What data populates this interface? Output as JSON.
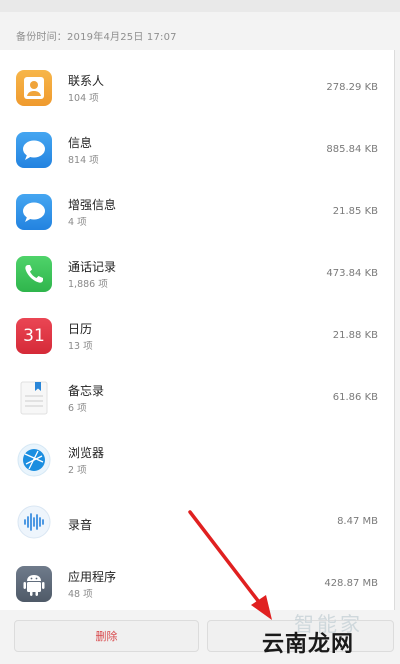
{
  "header": {
    "backup_time": "备份时间：2019年4月25日 17:07"
  },
  "items": [
    {
      "name": "联系人",
      "count": "104 项",
      "size": "278.29 KB",
      "icon": "contacts-icon"
    },
    {
      "name": "信息",
      "count": "814 项",
      "size": "885.84 KB",
      "icon": "messages-icon"
    },
    {
      "name": "增强信息",
      "count": "4 项",
      "size": "21.85 KB",
      "icon": "enhanced-messages-icon"
    },
    {
      "name": "通话记录",
      "count": "1,886 项",
      "size": "473.84 KB",
      "icon": "phone-icon"
    },
    {
      "name": "日历",
      "count": "13 项",
      "size": "21.88 KB",
      "icon": "calendar-icon",
      "icon_text": "31"
    },
    {
      "name": "备忘录",
      "count": "6 项",
      "size": "61.86 KB",
      "icon": "memo-icon"
    },
    {
      "name": "浏览器",
      "count": "2 项",
      "size": "",
      "icon": "browser-icon"
    },
    {
      "name": "录音",
      "count": "",
      "size": "8.47 MB",
      "icon": "recorder-icon"
    },
    {
      "name": "应用程序",
      "count": "48 项",
      "size": "428.87 MB",
      "icon": "android-icon"
    }
  ],
  "footer": {
    "delete_label": "删除",
    "watermark_faint": "智能家",
    "watermark_main": "云南龙网"
  },
  "colors": {
    "contacts": "#f3a43a",
    "messages": "#2c8fe6",
    "phone": "#3dc45a",
    "calendar": "#e0323f",
    "delete": "#d8484b",
    "arrow": "#e02020"
  }
}
